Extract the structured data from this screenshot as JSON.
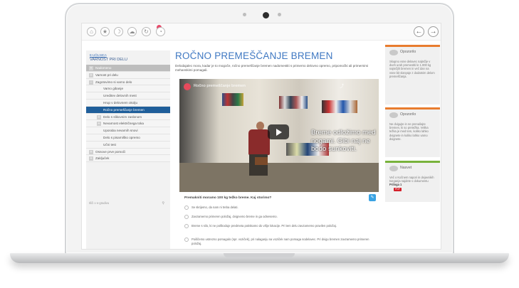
{
  "toolbar": {
    "icons": [
      "home-icon",
      "star-icon",
      "moon-icon",
      "cloud-icon",
      "refresh-icon",
      "chart-icon"
    ],
    "nav": {
      "back": "←",
      "forward": "→"
    }
  },
  "sidebar": {
    "course_small": "E-UČILNICA",
    "course_title": "VARNOST PRI DELU",
    "items": [
      {
        "label": "Nadomeno"
      },
      {
        "label": "Varnost pri delu"
      },
      {
        "label": "Zagotovimo si varno delo"
      },
      {
        "label": "Varno gibanje"
      },
      {
        "label": "Ureditev delovnih mest"
      },
      {
        "label": "Hrup v delovnem okolju"
      },
      {
        "label": "Ročno premeščanje bremen"
      },
      {
        "label": "Delo s slikovnim zaslonom"
      },
      {
        "label": "Nevarnost električnega toka"
      },
      {
        "label": "Uporaba nevarnih snovi"
      },
      {
        "label": "Delo s pisarniško opremo"
      },
      {
        "label": "Učni test"
      },
      {
        "label": "Osnove prve pomoči"
      },
      {
        "label": "Zaključek"
      }
    ],
    "search_placeholder": "Išči v e-gradivu"
  },
  "main": {
    "title": "ROČNO PREMEŠČANJE BREMEN",
    "intro": "Delodajalec mora, kadar je to mogoče, ročno premeščanje bremen nadomestiti s primerno delovno opremo, pripomočki ali primernimi mehanskimi pomagali.",
    "video": {
      "title": "Ročno premeščanje bremen",
      "subtitle": "Breme odložimo med nogami. Gibi naj ne bodo sunkoviti."
    },
    "quiz": {
      "question": "Premakniti moramo 100 kg težko breme. Kaj storimo?",
      "options": [
        "Se skrijemo, da nam ni treba delati.",
        "Zavzamemo primeren položaj, dvignemo breme in ga odnesemo.",
        "Breme s silo, ki ne poškoduje predmeta potiskamo do višje lokacije. Pri tem delu zavzamemo pravilen položaj.",
        "Poiščemo ustrezno pomagalo (npr. voziček), pri nalaganju na voziček nam pomaga sodelavec. Pri dvigu bremen zavzamemo primeren položaj."
      ]
    }
  },
  "right": {
    "cards": [
      {
        "title": "Opozorilo",
        "body": "Skupno vsne delavec najtežje v dveh urah premestiti le 1.000 kg najtežjih bremen in več dan na vsne bit slanyaje z dodatnim delom premeščanja.",
        "accent": "#e87c2e"
      },
      {
        "title": "Opozorilo",
        "body": "Ne dvigujte in ne prenašajte bremen, ki so pretežka. Velika težka je med tem, koliko lahko dvignete in koliko lahko varno dvignete.",
        "accent": "#e87c2e"
      },
      {
        "title": "Nasvet",
        "body": "Več o Kočnem napori in dejavnikih tveganja najdete v dokumentu ",
        "link": "Priloga 1",
        "badge": "PDF",
        "accent": "#79b33c"
      }
    ]
  }
}
